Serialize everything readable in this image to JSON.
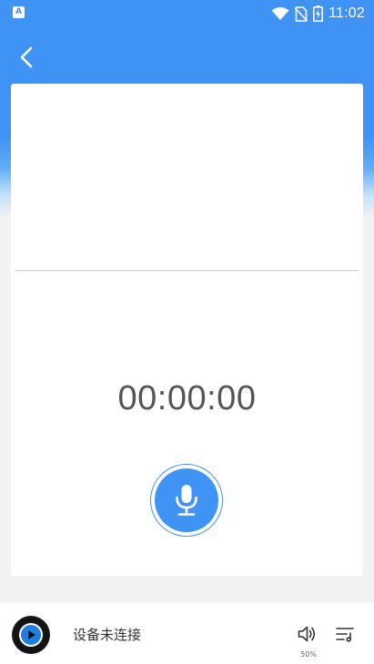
{
  "status_bar": {
    "app_icon_letter": "A",
    "time": "11:02",
    "icons": [
      "wifi-icon",
      "no-sim-icon",
      "battery-charging-icon"
    ]
  },
  "header": {
    "back_icon": "chevron-left-icon"
  },
  "recorder": {
    "timer": "00:00:00",
    "mic_icon": "microphone-icon"
  },
  "player": {
    "device_status": "设备未连接",
    "volume_level": "50%",
    "play_icon": "play-icon",
    "volume_icon": "speaker-icon",
    "playlist_icon": "playlist-icon"
  },
  "colors": {
    "accent": "#3f93f4",
    "background": "#f2f2f2",
    "card": "#ffffff",
    "divider": "#a9d6d2",
    "timer_text": "#555555"
  }
}
